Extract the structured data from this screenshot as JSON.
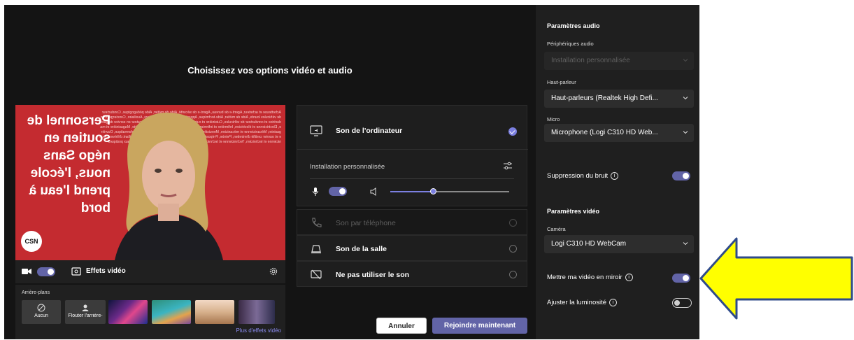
{
  "window": {
    "title": "Choisissez vos options vidéo et audio"
  },
  "video_preview": {
    "overlay_text": "Personnel de soutien en négo Sans nous, l'école prend l'eau à bord",
    "logo_text": "CSN",
    "camera_icon": "video-camera-icon",
    "effects_label": "Effets vidéo",
    "settings_icon": "gear-icon"
  },
  "backgrounds": {
    "label": "Arrière-plans",
    "items": [
      {
        "label": "Aucun",
        "icon": "none-icon"
      },
      {
        "label": "Flouter l'arrière-",
        "icon": "blur-icon"
      }
    ],
    "more_label": "Plus d'effets vidéo"
  },
  "audio_options": {
    "computer": {
      "label": "Son de l'ordinateur",
      "selected": true
    },
    "device_label": "Installation personnalisée",
    "volume_fraction": 0.36,
    "phone": {
      "label": "Son par téléphone",
      "disabled": true
    },
    "room": {
      "label": "Son de la salle"
    },
    "no_audio": {
      "label": "Ne pas utiliser le son"
    }
  },
  "actions": {
    "cancel_label": "Annuler",
    "join_label": "Rejoindre maintenant"
  },
  "side": {
    "audio_title": "Paramètres audio",
    "audio_devices_label": "Périphériques audio",
    "audio_devices_value": "Installation personnalisée",
    "speaker_label": "Haut-parleur",
    "speaker_value": "Haut-parleurs (Realtek High Defi...",
    "mic_label": "Micro",
    "mic_value": "Microphone (Logi C310 HD Web...",
    "noise_label": "Suppression du bruit",
    "noise_on": true,
    "video_title": "Paramètres vidéo",
    "camera_label": "Caméra",
    "camera_value": "Logi C310 HD WebCam",
    "mirror_label": "Mettre ma vidéo en miroir",
    "mirror_on": true,
    "brightness_label": "Ajuster la luminosité",
    "brightness_on": false
  },
  "colors": {
    "accent": "#6264a7",
    "arrow_fill": "#ffff00",
    "arrow_stroke": "#2f4b8a",
    "video_bg": "#c42b30"
  }
}
